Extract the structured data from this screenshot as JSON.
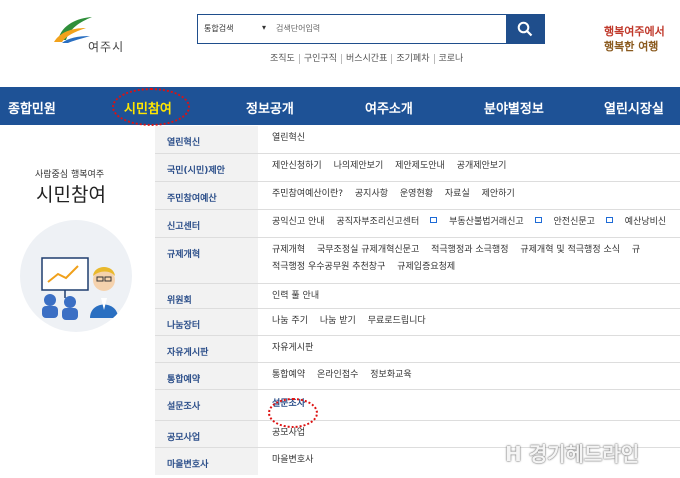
{
  "logo": {
    "text": "여주시"
  },
  "search": {
    "scope": "통합검색",
    "placeholder": "검색단어입력"
  },
  "quick_links": [
    "조직도",
    "구인구직",
    "버스시간표",
    "조기폐차",
    "코로나"
  ],
  "banner": {
    "line1": "행복여주에서",
    "line2": "행복한 여행"
  },
  "nav": {
    "items": [
      "종합민원",
      "시민참여",
      "정보공개",
      "여주소개",
      "분야별정보",
      "열린시장실"
    ]
  },
  "side": {
    "subtitle": "사람중심 행복여주",
    "title": "시민참여"
  },
  "table": {
    "rows": [
      {
        "cat": "열린혁신",
        "links": [
          "열린혁신"
        ]
      },
      {
        "cat": "국민(시민)제안",
        "links": [
          "제안신청하기",
          "나의제안보기",
          "제안제도안내",
          "공개제안보기"
        ]
      },
      {
        "cat": "주민참여예산",
        "links": [
          "주민참여예산이란?",
          "공지사항",
          "운영현황",
          "자료실",
          "제안하기"
        ]
      },
      {
        "cat": "신고센터",
        "links": [
          "공익신고 안내",
          "공직자부조리신고센터",
          "부동산불법거래신고",
          "안전신문고",
          "예산낭비신"
        ]
      },
      {
        "cat": "규제개혁",
        "links": [
          "규제개혁",
          "국무조정실 규제개혁신문고",
          "적극행정과 소극행정",
          "규제개혁 및 적극행정 소식",
          "규",
          "적극행정 우수공무원 추천창구",
          "규제입증요청제"
        ]
      },
      {
        "cat": "위원회",
        "links": [
          "인력 풀 안내"
        ]
      },
      {
        "cat": "나눔장터",
        "links": [
          "나눔 주기",
          "나눔 받기",
          "무료로드립니다"
        ]
      },
      {
        "cat": "자유게시판",
        "links": [
          "자유게시판"
        ]
      },
      {
        "cat": "통합예약",
        "links": [
          "통합예약",
          "온라인접수",
          "정보화교육"
        ]
      },
      {
        "cat": "설문조사",
        "links": [
          "설문조사"
        ]
      },
      {
        "cat": "공모사업",
        "links": [
          "공모사업"
        ]
      },
      {
        "cat": "마을변호사",
        "links": [
          "마을변호사"
        ]
      }
    ]
  },
  "watermark": {
    "text": "경기헤드라인"
  }
}
